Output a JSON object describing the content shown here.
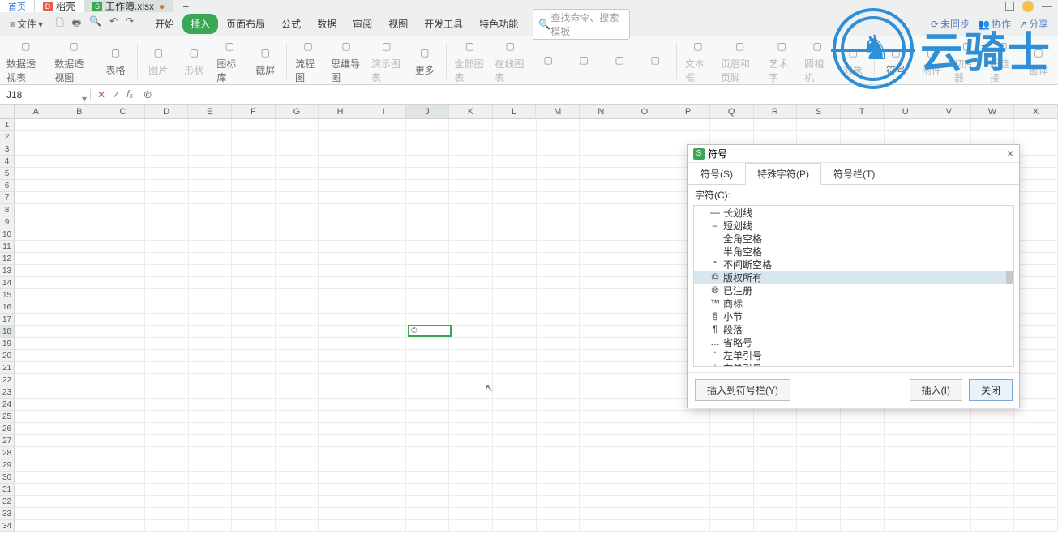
{
  "titlebar": {
    "home": "首页",
    "dk": "稻壳",
    "file": "工作簿.xlsx",
    "dot": "●",
    "add": "+"
  },
  "menubar": {
    "file": "文件",
    "tabs": [
      "开始",
      "插入",
      "页面布局",
      "公式",
      "数据",
      "审阅",
      "视图",
      "开发工具",
      "特色功能"
    ],
    "active_index": 1,
    "search_placeholder": "查找命令、搜索模板",
    "right": {
      "sync": "未同步",
      "coop": "协作",
      "share": "分享"
    }
  },
  "ribbon": [
    {
      "label": "数据透视表",
      "dim": false
    },
    {
      "label": "数据透视图",
      "dim": false
    },
    {
      "label": "表格",
      "dim": false
    },
    {
      "label": "图片",
      "dim": true
    },
    {
      "label": "形状",
      "dim": true
    },
    {
      "label": "图标库",
      "dim": false
    },
    {
      "label": "截屏",
      "dim": false
    },
    {
      "label": "流程图",
      "dim": false
    },
    {
      "label": "思维导图",
      "dim": false
    },
    {
      "label": "演示图表",
      "dim": true
    },
    {
      "label": "更多",
      "dim": false
    },
    {
      "label": "全部图表",
      "dim": true
    },
    {
      "label": "在线图表",
      "dim": true
    },
    {
      "label": "",
      "dim": true
    },
    {
      "label": "",
      "dim": true
    },
    {
      "label": "",
      "dim": true
    },
    {
      "label": "",
      "dim": true
    },
    {
      "label": "文本框",
      "dim": true
    },
    {
      "label": "页眉和页脚",
      "dim": true
    },
    {
      "label": "艺术字",
      "dim": true
    },
    {
      "label": "照相机",
      "dim": true
    },
    {
      "label": "对象",
      "dim": true
    },
    {
      "label": "符号",
      "dim": false
    },
    {
      "label": "附件",
      "dim": true
    },
    {
      "label": "切片器",
      "dim": true
    },
    {
      "label": "超链接",
      "dim": true
    },
    {
      "label": "窗体",
      "dim": true
    }
  ],
  "namebox": {
    "ref": "J18",
    "fx_value": "©"
  },
  "columns": [
    "A",
    "B",
    "C",
    "D",
    "E",
    "F",
    "G",
    "H",
    "I",
    "J",
    "K",
    "L",
    "M",
    "N",
    "O",
    "P",
    "Q",
    "R",
    "S",
    "T",
    "U",
    "V",
    "W",
    "X"
  ],
  "sel_col": "J",
  "rows_count": 34,
  "sel_row": 18,
  "active_cell_value": "©",
  "dialog": {
    "title": "符号",
    "tabs": [
      "符号(S)",
      "特殊字符(P)",
      "符号栏(T)"
    ],
    "active_tab": 1,
    "field_label": "字符(C):",
    "items": [
      {
        "sym": "—",
        "name": "长划线"
      },
      {
        "sym": "–",
        "name": "短划线"
      },
      {
        "sym": "",
        "name": "全角空格"
      },
      {
        "sym": "",
        "name": "半角空格"
      },
      {
        "sym": "°",
        "name": "不间断空格"
      },
      {
        "sym": "©",
        "name": "版权所有"
      },
      {
        "sym": "®",
        "name": "已注册"
      },
      {
        "sym": "™",
        "name": "商标"
      },
      {
        "sym": "§",
        "name": "小节"
      },
      {
        "sym": "¶",
        "name": "段落"
      },
      {
        "sym": "…",
        "name": "省略号"
      },
      {
        "sym": "‘",
        "name": "左单引号"
      },
      {
        "sym": "’",
        "name": "右单引号"
      }
    ],
    "sel_index": 5,
    "btn_toolbar": "插入到符号栏(Y)",
    "btn_insert": "插入(I)",
    "btn_close": "关闭"
  },
  "watermark": "云骑士"
}
